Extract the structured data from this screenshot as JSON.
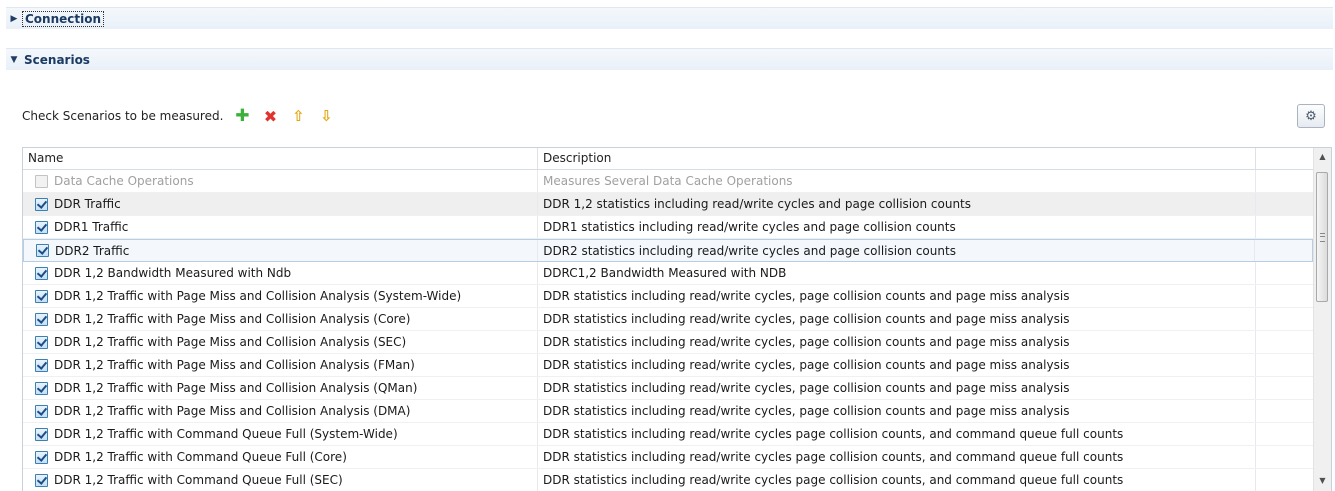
{
  "sections": {
    "connection": {
      "label": "Connection",
      "expanded": false
    },
    "scenarios": {
      "label": "Scenarios",
      "expanded": true
    }
  },
  "toolbar": {
    "instruction": "Check Scenarios to be measured.",
    "buttons": [
      {
        "name": "add-scenario-button",
        "icon": "plus-icon"
      },
      {
        "name": "remove-scenario-button",
        "icon": "red-x-icon"
      },
      {
        "name": "move-up-button",
        "icon": "arrow-up-icon"
      },
      {
        "name": "move-down-button",
        "icon": "arrow-down-icon"
      }
    ],
    "filter_icon": "filter-icon"
  },
  "table": {
    "columns": [
      "Name",
      "Description"
    ],
    "rows": [
      {
        "name": "Data Cache Operations",
        "description": "Measures Several Data Cache Operations",
        "checked": false,
        "disabled": true
      },
      {
        "name": "DDR Traffic",
        "description": "DDR 1,2 statistics including read/write cycles and page collision counts",
        "checked": true,
        "state": "hover"
      },
      {
        "name": "DDR1 Traffic",
        "description": "DDR1 statistics including read/write cycles and page collision counts",
        "checked": true
      },
      {
        "name": "DDR2 Traffic",
        "description": "DDR2 statistics including read/write cycles and page collision counts",
        "checked": true,
        "state": "selected"
      },
      {
        "name": "DDR 1,2 Bandwidth Measured with Ndb",
        "description": "DDRC1,2 Bandwidth Measured with NDB",
        "checked": true
      },
      {
        "name": "DDR 1,2 Traffic with Page Miss and Collision Analysis (System-Wide)",
        "description": "DDR statistics including read/write cycles, page collision counts and page miss analysis",
        "checked": true
      },
      {
        "name": "DDR 1,2 Traffic with Page Miss and Collision Analysis (Core)",
        "description": "DDR statistics including read/write cycles, page collision counts and page miss analysis",
        "checked": true
      },
      {
        "name": "DDR 1,2 Traffic with Page Miss and Collision Analysis (SEC)",
        "description": "DDR statistics including read/write cycles, page collision counts and page miss analysis",
        "checked": true
      },
      {
        "name": "DDR 1,2 Traffic with Page Miss and Collision Analysis (FMan)",
        "description": "DDR statistics including read/write cycles, page collision counts and page miss analysis",
        "checked": true
      },
      {
        "name": "DDR 1,2 Traffic with Page Miss and Collision Analysis (QMan)",
        "description": "DDR statistics including read/write cycles, page collision counts and page miss analysis",
        "checked": true
      },
      {
        "name": "DDR 1,2 Traffic with Page Miss and Collision Analysis (DMA)",
        "description": "DDR statistics including read/write cycles, page collision counts and page miss analysis",
        "checked": true
      },
      {
        "name": "DDR 1,2 Traffic with Command Queue Full (System-Wide)",
        "description": "DDR statistics including read/write cycles page collision counts, and command queue full counts",
        "checked": true
      },
      {
        "name": "DDR 1,2 Traffic with Command Queue Full (Core)",
        "description": "DDR statistics including read/write cycles page collision counts, and command queue full counts",
        "checked": true
      },
      {
        "name": "DDR 1,2 Traffic with Command Queue Full (SEC)",
        "description": "DDR statistics including read/write cycles page collision counts, and command queue full counts",
        "checked": true
      }
    ]
  }
}
